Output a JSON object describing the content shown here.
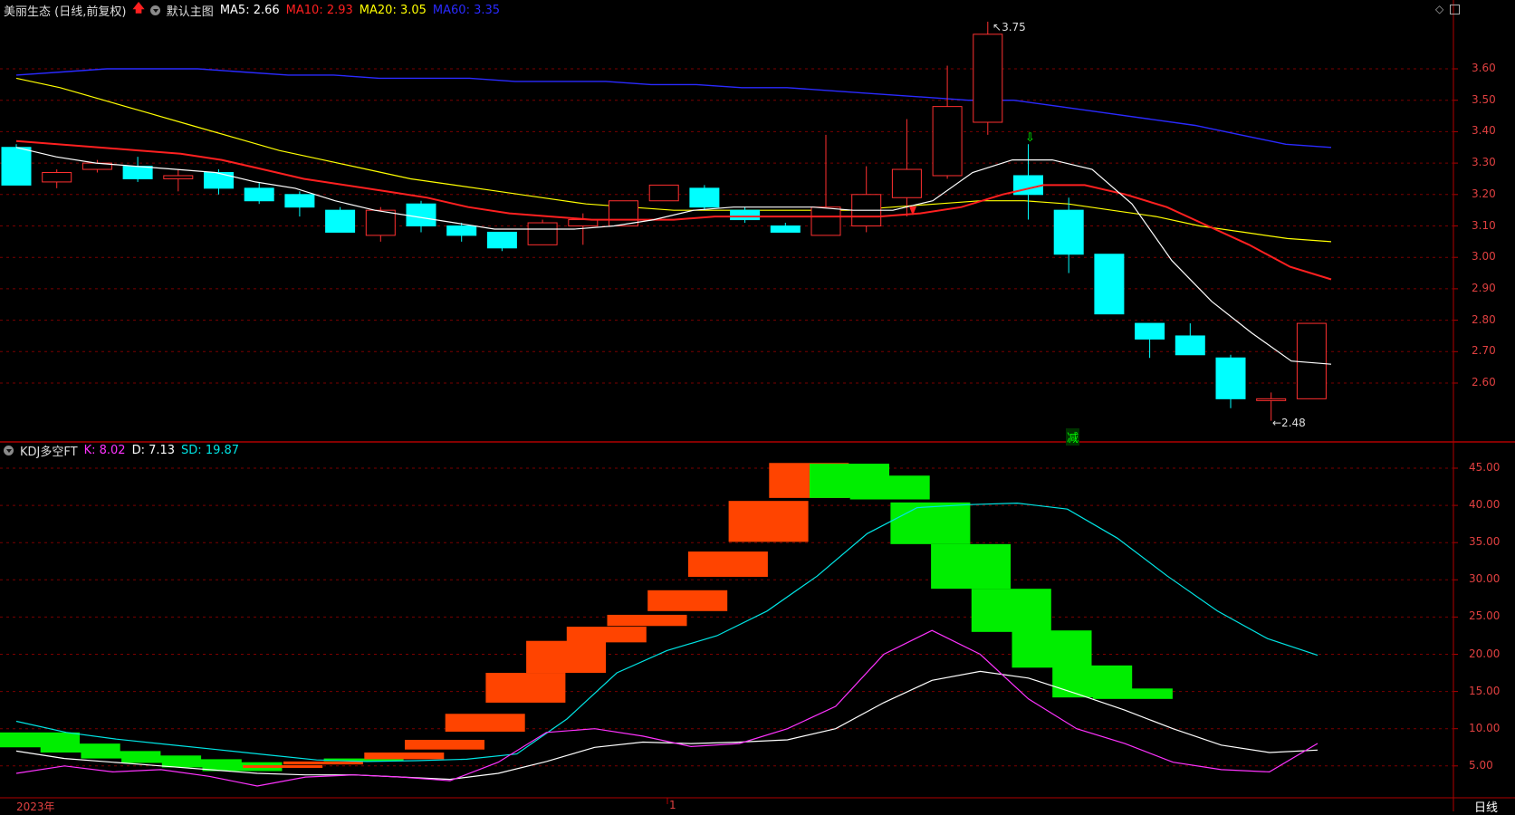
{
  "price_pane": {
    "stock_name": "美丽生态 (日线,前复权)",
    "template_label": "默认主图",
    "ma5": {
      "label": "MA5:",
      "value": "2.66",
      "color": "#ffffff"
    },
    "ma10": {
      "label": "MA10:",
      "value": "2.93",
      "color": "#ff2020"
    },
    "ma20": {
      "label": "MA20:",
      "value": "3.05",
      "color": "#ffff00"
    },
    "ma60": {
      "label": "MA60:",
      "value": "3.35",
      "color": "#2a2aff"
    },
    "high_marker": "3.75",
    "low_marker": "←2.48",
    "signal_text": "减",
    "y_ticks": [
      "3.60",
      "3.50",
      "3.40",
      "3.30",
      "3.20",
      "3.10",
      "3.00",
      "2.90",
      "2.80",
      "2.70",
      "2.60"
    ]
  },
  "kdj_pane": {
    "indicator_name": "KDJ多空FT",
    "k": {
      "label": "K:",
      "value": "8.02",
      "color": "#ff33ff"
    },
    "d": {
      "label": "D:",
      "value": "7.13",
      "color": "#ffffff"
    },
    "sd": {
      "label": "SD:",
      "value": "19.87",
      "color": "#00e5e5"
    },
    "y_ticks": [
      "45.00",
      "40.00",
      "35.00",
      "30.00",
      "25.00",
      "20.00",
      "15.00",
      "10.00",
      "5.00"
    ]
  },
  "x_axis": {
    "year_label": "2023年",
    "month_label": "1",
    "period_label": "日线"
  },
  "colors": {
    "up": "#ff3030",
    "down": "#00ffff",
    "grid": "#7a0000",
    "bull_block": "#ff4400",
    "bear_block": "#00ee00"
  },
  "chart_data": {
    "type": "candlestick",
    "candles": [
      [
        3.35,
        3.23,
        3.36,
        3.23
      ],
      [
        3.24,
        3.27,
        3.28,
        3.22
      ],
      [
        3.28,
        3.3,
        3.31,
        3.27
      ],
      [
        3.29,
        3.25,
        3.32,
        3.24
      ],
      [
        3.25,
        3.26,
        3.28,
        3.21
      ],
      [
        3.27,
        3.22,
        3.28,
        3.2
      ],
      [
        3.22,
        3.18,
        3.24,
        3.17
      ],
      [
        3.2,
        3.16,
        3.21,
        3.13
      ],
      [
        3.15,
        3.08,
        3.16,
        3.08
      ],
      [
        3.07,
        3.15,
        3.16,
        3.05
      ],
      [
        3.17,
        3.1,
        3.18,
        3.08
      ],
      [
        3.1,
        3.07,
        3.11,
        3.05
      ],
      [
        3.08,
        3.03,
        3.08,
        3.02
      ],
      [
        3.04,
        3.11,
        3.12,
        3.04
      ],
      [
        3.1,
        3.12,
        3.14,
        3.04
      ],
      [
        3.1,
        3.18,
        3.18,
        3.1
      ],
      [
        3.18,
        3.23,
        3.23,
        3.18
      ],
      [
        3.22,
        3.16,
        3.23,
        3.15
      ],
      [
        3.15,
        3.12,
        3.16,
        3.11
      ],
      [
        3.1,
        3.08,
        3.11,
        3.08
      ],
      [
        3.07,
        3.16,
        3.39,
        3.07
      ],
      [
        3.1,
        3.2,
        3.29,
        3.08
      ],
      [
        3.19,
        3.28,
        3.44,
        3.13
      ],
      [
        3.26,
        3.48,
        3.61,
        3.25
      ],
      [
        3.43,
        3.71,
        3.75,
        3.39
      ],
      [
        3.26,
        3.2,
        3.36,
        3.12
      ],
      [
        3.15,
        3.01,
        3.19,
        2.95
      ],
      [
        3.01,
        2.82,
        3.01,
        2.82
      ],
      [
        2.79,
        2.74,
        2.79,
        2.68
      ],
      [
        2.75,
        2.69,
        2.79,
        2.69
      ],
      [
        2.68,
        2.55,
        2.69,
        2.52
      ],
      [
        2.55,
        2.55,
        2.57,
        2.48
      ],
      [
        2.55,
        2.79,
        2.79,
        2.55
      ]
    ],
    "ma5": [
      3.35,
      3.32,
      3.3,
      3.29,
      3.28,
      3.27,
      3.24,
      3.22,
      3.18,
      3.15,
      3.13,
      3.11,
      3.09,
      3.09,
      3.09,
      3.1,
      3.12,
      3.15,
      3.16,
      3.16,
      3.16,
      3.15,
      3.15,
      3.18,
      3.27,
      3.31,
      3.31,
      3.28,
      3.17,
      2.99,
      2.86,
      2.76,
      2.67,
      2.66
    ],
    "ma10": [
      3.37,
      3.36,
      3.35,
      3.34,
      3.33,
      3.31,
      3.28,
      3.25,
      3.23,
      3.21,
      3.19,
      3.16,
      3.14,
      3.13,
      3.12,
      3.12,
      3.12,
      3.13,
      3.13,
      3.13,
      3.13,
      3.13,
      3.14,
      3.16,
      3.2,
      3.23,
      3.23,
      3.2,
      3.16,
      3.1,
      3.04,
      2.97,
      2.93
    ],
    "ma20": [
      3.57,
      3.54,
      3.5,
      3.46,
      3.42,
      3.38,
      3.34,
      3.31,
      3.28,
      3.25,
      3.23,
      3.21,
      3.19,
      3.17,
      3.16,
      3.15,
      3.15,
      3.15,
      3.15,
      3.15,
      3.16,
      3.17,
      3.18,
      3.18,
      3.17,
      3.15,
      3.13,
      3.1,
      3.08,
      3.06,
      3.05
    ],
    "ma60": [
      3.58,
      3.59,
      3.6,
      3.6,
      3.6,
      3.59,
      3.58,
      3.58,
      3.57,
      3.57,
      3.57,
      3.56,
      3.56,
      3.56,
      3.55,
      3.55,
      3.54,
      3.54,
      3.53,
      3.52,
      3.51,
      3.5,
      3.5,
      3.48,
      3.46,
      3.44,
      3.42,
      3.39,
      3.36,
      3.35
    ],
    "kdj": {
      "k": [
        4,
        5,
        4.2,
        4.5,
        3.6,
        2.3,
        3.5,
        3.8,
        3.5,
        3.0,
        5.5,
        9.5,
        10,
        9,
        7.6,
        8,
        10,
        13,
        20,
        23.2,
        20,
        14,
        10,
        8,
        5.5,
        4.5,
        4.2,
        8.02
      ],
      "d": [
        7,
        6,
        5.5,
        5,
        4.5,
        4,
        3.8,
        3.8,
        3.5,
        3.2,
        4,
        5.6,
        7.5,
        8.2,
        8,
        8.2,
        8.5,
        10,
        13.5,
        16.5,
        17.7,
        16.8,
        14.7,
        12.5,
        10,
        7.8,
        6.8,
        7.13
      ],
      "sd": [
        11.0,
        9.5,
        8.6,
        7.9,
        7.2,
        6.5,
        5.8,
        5.6,
        5.7,
        5.9,
        6.6,
        11.3,
        17.5,
        20.5,
        22.5,
        25.8,
        30.5,
        36.2,
        39.7,
        40.1,
        40.3,
        39.5,
        35.6,
        30.5,
        25.8,
        22.1,
        19.87
      ],
      "blocks": [
        [
          9.5,
          7.5,
          "bear"
        ],
        [
          8.0,
          6.8,
          "bear"
        ],
        [
          7.0,
          6.0,
          "bear"
        ],
        [
          6.4,
          5.4,
          "bear"
        ],
        [
          5.9,
          4.8,
          "bear"
        ],
        [
          5.5,
          4.3,
          "bear"
        ],
        [
          5.1,
          4.9,
          "bull"
        ],
        [
          5.6,
          5.2,
          "bull"
        ],
        [
          6.0,
          5.8,
          "bear"
        ],
        [
          6.8,
          5.9,
          "bull"
        ],
        [
          8.5,
          7.2,
          "bull"
        ],
        [
          12.0,
          9.6,
          "bull"
        ],
        [
          17.5,
          13.5,
          "bull"
        ],
        [
          21.8,
          17.5,
          "bull"
        ],
        [
          23.7,
          21.6,
          "bull"
        ],
        [
          25.3,
          23.8,
          "bull"
        ],
        [
          28.6,
          25.8,
          "bull"
        ],
        [
          33.8,
          30.4,
          "bull"
        ],
        [
          40.6,
          35.1,
          "bull"
        ],
        [
          45.7,
          41.0,
          "bull"
        ],
        [
          45.6,
          41.0,
          "bear"
        ],
        [
          44.0,
          40.8,
          "bear"
        ],
        [
          40.4,
          34.8,
          "bear"
        ],
        [
          34.8,
          28.8,
          "bear"
        ],
        [
          28.8,
          23.0,
          "bear"
        ],
        [
          23.2,
          18.2,
          "bear"
        ],
        [
          18.5,
          14.2,
          "bear"
        ],
        [
          15.4,
          14.0,
          "bear"
        ]
      ]
    }
  }
}
